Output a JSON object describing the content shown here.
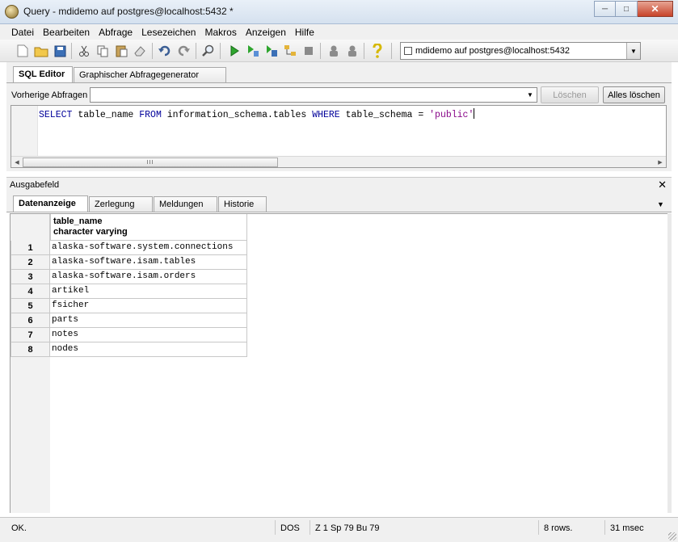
{
  "window": {
    "title": "Query - mdidemo auf postgres@localhost:5432 *",
    "controls": {
      "minimize": "─",
      "maximize": "□",
      "close": "✕"
    }
  },
  "menubar": {
    "items": [
      {
        "label": "Datei"
      },
      {
        "label": "Bearbeiten"
      },
      {
        "label": "Abfrage"
      },
      {
        "label": "Lesezeichen"
      },
      {
        "label": "Makros"
      },
      {
        "label": "Anzeigen"
      },
      {
        "label": "Hilfe"
      }
    ]
  },
  "toolbar": {
    "icons": [
      "new-file-icon",
      "open-folder-icon",
      "save-icon",
      "cut-icon",
      "copy-icon",
      "paste-icon",
      "clear-icon",
      "undo-icon",
      "redo-icon",
      "find-icon",
      "execute-icon",
      "explain-icon",
      "execute-to-file-icon",
      "query-plan-icon",
      "cancel-icon",
      "macro-icon",
      "macro-record-icon",
      "help-icon"
    ],
    "connection": {
      "value": "mdidemo auf postgres@localhost:5432"
    }
  },
  "editor_tabs": [
    {
      "label": "SQL Editor",
      "active": true
    },
    {
      "label": "Graphischer Abfragegenerator",
      "active": false
    }
  ],
  "previous_queries": {
    "label": "Vorherige Abfragen",
    "value": "",
    "delete_label": "Löschen",
    "delete_all_label": "Alles löschen"
  },
  "sql": {
    "parts": [
      {
        "t": "kw",
        "text": "SELECT"
      },
      {
        "t": "txt",
        "text": " table_name "
      },
      {
        "t": "kw",
        "text": "FROM"
      },
      {
        "t": "txt",
        "text": " information_schema.tables "
      },
      {
        "t": "kw",
        "text": "WHERE"
      },
      {
        "t": "txt",
        "text": " table_schema = "
      },
      {
        "t": "str",
        "text": "'public'"
      }
    ],
    "scroll_thumb": "III"
  },
  "output": {
    "title": "Ausgabefeld",
    "close": "✕",
    "tabs": [
      {
        "label": "Datenanzeige",
        "active": true
      },
      {
        "label": "Zerlegung",
        "active": false
      },
      {
        "label": "Meldungen",
        "active": false
      },
      {
        "label": "Historie",
        "active": false
      }
    ],
    "dropdown": "▼"
  },
  "grid": {
    "column": {
      "name": "table_name",
      "type": "character varying"
    },
    "rows": [
      {
        "n": "1",
        "value": "alaska-software.system.connections"
      },
      {
        "n": "2",
        "value": "alaska-software.isam.tables"
      },
      {
        "n": "3",
        "value": "alaska-software.isam.orders"
      },
      {
        "n": "4",
        "value": "artikel"
      },
      {
        "n": "5",
        "value": "fsicher"
      },
      {
        "n": "6",
        "value": "parts"
      },
      {
        "n": "7",
        "value": "notes"
      },
      {
        "n": "8",
        "value": "nodes"
      }
    ]
  },
  "statusbar": {
    "status": "OK.",
    "encoding": "DOS",
    "position": "Z 1 Sp 79  Bu 79",
    "rows": "8 rows.",
    "time": "31 msec"
  }
}
